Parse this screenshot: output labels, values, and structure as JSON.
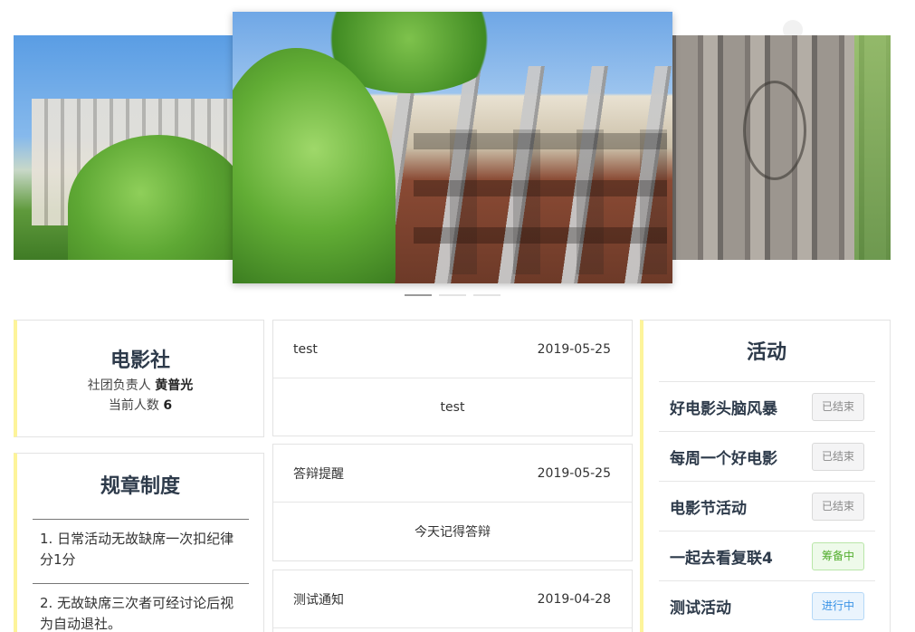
{
  "carousel": {
    "slides": [
      "campus-left",
      "campus-center",
      "campus-right"
    ],
    "active_index": 0
  },
  "club": {
    "name": "电影社",
    "leader_label": "社团负责人",
    "leader_name": "黄普光",
    "members_label": "当前人数",
    "members_count": "6"
  },
  "rules": {
    "title": "规章制度",
    "items": [
      "1.  日常活动无故缺席一次扣纪律分1分",
      "2. 无故缺席三次者可经讨论后视为自动退社。"
    ]
  },
  "notices": [
    {
      "title": "test",
      "date": "2019-05-25",
      "content": "test"
    },
    {
      "title": "答辩提醒",
      "date": "2019-05-25",
      "content": "今天记得答辩"
    },
    {
      "title": "测试通知",
      "date": "2019-04-28",
      "content": ""
    }
  ],
  "activities": {
    "title": "活动",
    "items": [
      {
        "name": "好电影头脑风暴",
        "status": "已结束"
      },
      {
        "name": "每周一个好电影",
        "status": "已结束"
      },
      {
        "name": "电影节活动",
        "status": "已结束"
      },
      {
        "name": "一起去看复联4",
        "status": "筹备中"
      },
      {
        "name": "测试活动",
        "status": "进行中"
      }
    ]
  },
  "colors": {
    "accent": "#fdf49a",
    "status_ended": "#f4f4f5",
    "status_preparing": "#52ad2e",
    "status_ongoing": "#3a93e6"
  }
}
